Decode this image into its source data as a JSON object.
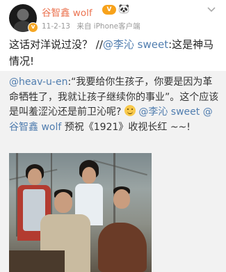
{
  "header": {
    "username": "谷智鑫 wolf",
    "vip_badge": "V",
    "panda_icon": "panda-icon",
    "verified_badge": "v",
    "date": "11-2-13",
    "source": "来自 iPhone客户端",
    "menu_icon": "chevron-down-icon"
  },
  "post": {
    "text_before": "这话对洋说过没？ //",
    "mention": "@李沁 sweet",
    "text_after": ":这是神马情况!"
  },
  "repost": {
    "author": "@heav-u-en",
    "quote": ":“我要给你生孩子，你要是因为革命牺牲了，我就让孩子继续你的事业”。这个应该是叫羞涩沁还是前卫沁呢?",
    "mention1": "@李沁 sweet",
    "mention2": "@谷智鑫 wolf",
    "text_end": "预祝《1921》收视长红 ~~!",
    "emoji_icon": "grin-emoji-icon"
  },
  "colors": {
    "username": "#eb7350",
    "mention": "#507daf",
    "repost_bg": "#f2f2f2"
  }
}
